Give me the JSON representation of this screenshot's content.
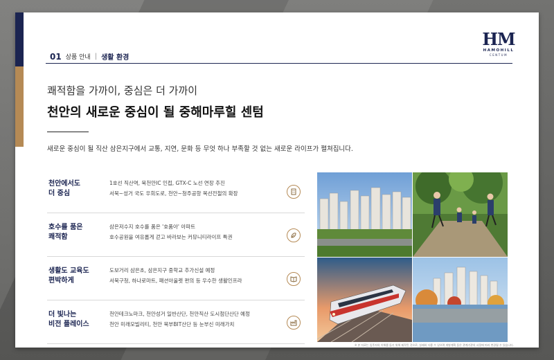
{
  "header": {
    "section_number": "01",
    "section_name": "상품 안내",
    "separator": "|",
    "current_page": "생활 환경"
  },
  "logo": {
    "mark": "HM",
    "word": "HAMOHILL",
    "sub": "CENTUM",
    "icon": "brand-logo"
  },
  "headline": {
    "line1": "쾌적함을 가까이, 중심은 더 가까이",
    "line2": "천안의 새로운 중심이 될 중해마루힐 센텀"
  },
  "intro": "새로운 중심이 될 직산 삼은지구에서 교통, 지연, 문화 등 무엇 하나 부족할 것 없는 새로운 라이프가 펼쳐집니다.",
  "features": [
    {
      "title": "천안에서도\n더 중심",
      "lines": [
        "1호선 직산역, 북천안IC 인접, GTX-C 노선 연장 추진",
        "서북~성거 국도 우회도로, 천안~청주공항 복선전철의 확장"
      ],
      "icon": "building-icon"
    },
    {
      "title": "호수를 품은\n쾌적함",
      "lines": [
        "삼은저수지 호수를 품은 '호품아' 아파트",
        "호수공원을 여유롭게 걷고 바라보는 커뮤니티라이프 특권"
      ],
      "icon": "leaf-icon"
    },
    {
      "title": "생활도 교육도\n편박하게",
      "lines": [
        "도보거리 삼은초, 삼은지구 중학교 추가신설 예정",
        "서북구청, 하나로마트, 패션아울렛 편의 등 우수한 생활인프라"
      ],
      "icon": "book-icon"
    },
    {
      "title": "더 빛나는\n비전 플레이스",
      "lines": [
        "천안테크노마크, 천안성거 일반산단, 천안직산 도시첨단산단 예정",
        "천안 미래모빌리티, 천안 북부BIT산단 등 눈부신 미래가치"
      ],
      "icon": "factory-icon"
    }
  ],
  "footnote": "※ 본 자료는 입주자의 이해를 돕기 위해 제작된 것으로, 실제와 다를 수 있으며 개발계획 등은 관계기관의 사정에 따라 변경될 수 있습니다."
}
